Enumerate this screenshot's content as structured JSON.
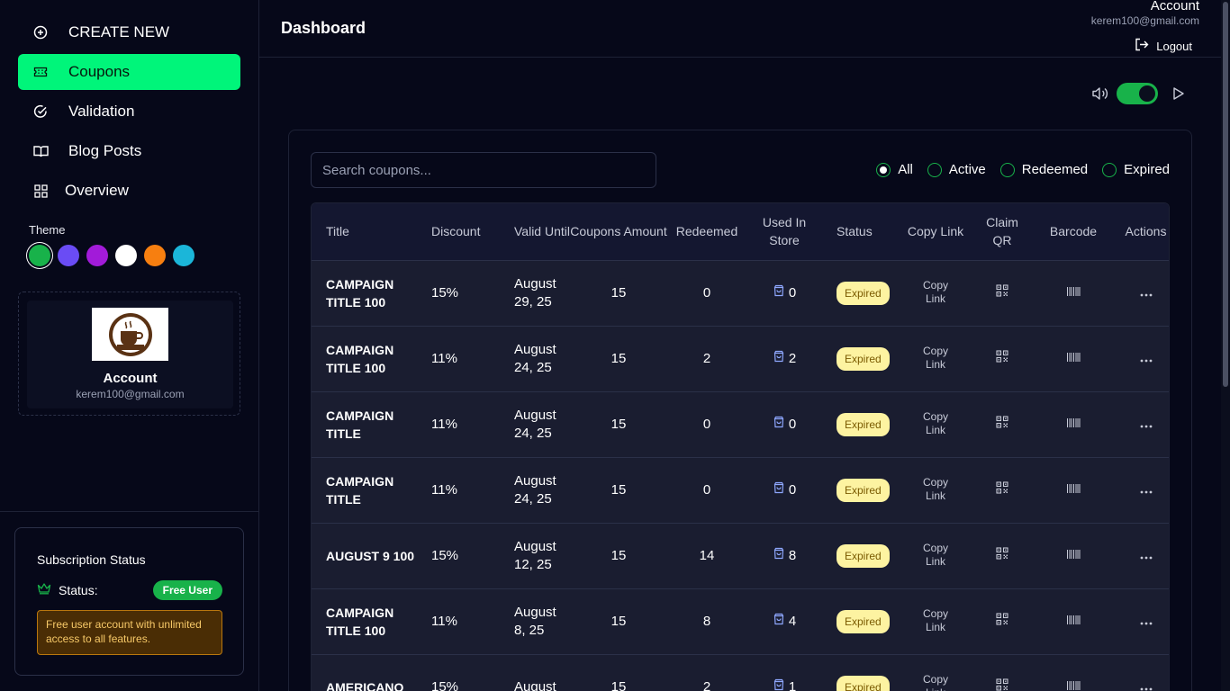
{
  "sidebar": {
    "nav": [
      {
        "label": "CREATE NEW",
        "icon": "plus-circle-icon"
      },
      {
        "label": "Coupons",
        "icon": "ticket-icon"
      },
      {
        "label": "Validation",
        "icon": "check-circle-icon"
      },
      {
        "label": "Blog Posts",
        "icon": "book-icon"
      },
      {
        "label": "Overview",
        "icon": "grid-icon"
      }
    ],
    "active_nav": "Coupons",
    "theme_label": "Theme",
    "theme_colors": [
      "#18b24a",
      "#6a4cf5",
      "#a21bd9",
      "#ffffff",
      "#f77f10",
      "#1bb6d9"
    ],
    "account": {
      "name": "Account",
      "email": "kerem100@gmail.com"
    },
    "subscription": {
      "title": "Subscription Status",
      "status_label": "Status:",
      "badge": "Free User",
      "note": "Free user account with unlimited access to all features."
    }
  },
  "header": {
    "title": "Dashboard",
    "account_name": "Account",
    "account_email": "kerem100@gmail.com",
    "logout": "Logout"
  },
  "controls": {
    "sound_on": true
  },
  "search": {
    "placeholder": "Search coupons..."
  },
  "filters": {
    "options": [
      "All",
      "Active",
      "Redeemed",
      "Expired"
    ],
    "selected": "All"
  },
  "table": {
    "headers": {
      "title": "Title",
      "discount": "Discount",
      "valid_until": "Valid Until",
      "amount": "Coupons Amount",
      "redeemed": "Redeemed",
      "used": "Used In Store",
      "status": "Status",
      "copy": "Copy Link",
      "claim": "Claim QR",
      "barcode": "Barcode",
      "actions": "Actions"
    },
    "copy_label": "Copy Link",
    "rows": [
      {
        "title": "CAMPAIGN TITLE 100",
        "discount": "15%",
        "valid": "August 29, 25",
        "amount": "15",
        "redeemed": "0",
        "used": "0",
        "status": "Expired"
      },
      {
        "title": "CAMPAIGN TITLE 100",
        "discount": "11%",
        "valid": "August 24, 25",
        "amount": "15",
        "redeemed": "2",
        "used": "2",
        "status": "Expired"
      },
      {
        "title": "CAMPAIGN TITLE",
        "discount": "11%",
        "valid": "August 24, 25",
        "amount": "15",
        "redeemed": "0",
        "used": "0",
        "status": "Expired"
      },
      {
        "title": "CAMPAIGN TITLE",
        "discount": "11%",
        "valid": "August 24, 25",
        "amount": "15",
        "redeemed": "0",
        "used": "0",
        "status": "Expired"
      },
      {
        "title": "AUGUST 9 100",
        "discount": "15%",
        "valid": "August 12, 25",
        "amount": "15",
        "redeemed": "14",
        "used": "8",
        "status": "Expired"
      },
      {
        "title": "CAMPAIGN TITLE 100",
        "discount": "11%",
        "valid": "August 8, 25",
        "amount": "15",
        "redeemed": "8",
        "used": "4",
        "status": "Expired"
      },
      {
        "title": "AMERICANO",
        "discount": "15%",
        "valid": "August",
        "amount": "15",
        "redeemed": "2",
        "used": "1",
        "status": "Expired"
      }
    ]
  }
}
